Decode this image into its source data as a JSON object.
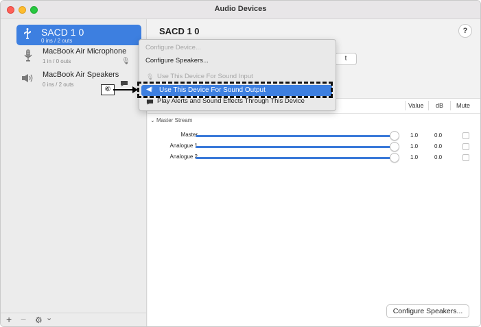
{
  "window": {
    "title": "Audio Devices"
  },
  "sidebar": {
    "devices": [
      {
        "name": "SACD 1 0",
        "sub": "0 ins / 2 outs",
        "icon": "usb-icon"
      },
      {
        "name": "MacBook Air Microphone",
        "sub": "1 in / 0 outs",
        "icon": "microphone-icon"
      },
      {
        "name": "MacBook Air Speakers",
        "sub": "0 ins / 2 outs",
        "icon": "speaker-icon"
      }
    ],
    "bottom": {
      "add": "+",
      "remove": "−",
      "gear": "⚙",
      "chevron": "⌄"
    }
  },
  "main": {
    "device_title": "SACD 1 0",
    "help_label": "?",
    "output_tab_stub": "t",
    "columns": {
      "value": "Value",
      "db": "dB",
      "mute": "Mute"
    },
    "stream_label": "Master Stream",
    "rows": [
      {
        "label": "Master",
        "value": "1.0",
        "db": "0.0"
      },
      {
        "label": "Analogue 1",
        "value": "1.0",
        "db": "0.0"
      },
      {
        "label": "Analogue 2",
        "value": "1.0",
        "db": "0.0"
      }
    ],
    "configure_button": "Configure Speakers..."
  },
  "context_menu": {
    "items": [
      {
        "label": "Configure Device...",
        "enabled": false
      },
      {
        "label": "Configure Speakers...",
        "enabled": true
      },
      {
        "label": "Use This Device For Sound Input",
        "enabled": false
      },
      {
        "label": "Use This Device For Sound Output",
        "enabled": true,
        "highlighted": true
      },
      {
        "label": "Play Alerts and Sound Effects Through This Device",
        "enabled": true
      }
    ]
  },
  "callout": {
    "label": "⑥"
  },
  "colors": {
    "accent": "#3d7fe0",
    "slider": "#3b7ad9",
    "dashed_border": "#111111"
  }
}
